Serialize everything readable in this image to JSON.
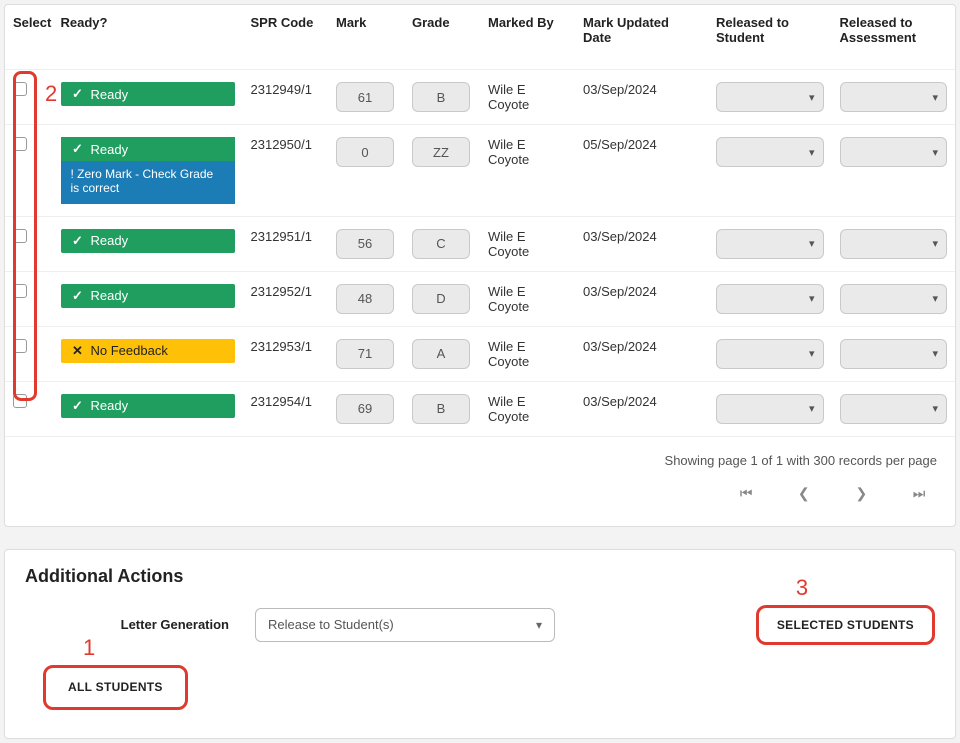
{
  "headers": {
    "select": "Select",
    "ready": "Ready?",
    "spr": "SPR Code",
    "mark": "Mark",
    "grade": "Grade",
    "by": "Marked By",
    "date": "Mark Updated Date",
    "rel_student": "Released to Student",
    "rel_assessment": "Released to Assessment"
  },
  "badge_labels": {
    "ready": "Ready",
    "no_feedback": "No Feedback",
    "zero_mark": "! Zero Mark - Check Grade is correct"
  },
  "rows": [
    {
      "ready_type": "ready",
      "spr": "2312949/1",
      "mark": "61",
      "grade": "B",
      "by": "Wile E Coyote",
      "date": "03/Sep/2024"
    },
    {
      "ready_type": "ready_warn",
      "spr": "2312950/1",
      "mark": "0",
      "grade": "ZZ",
      "by": "Wile E Coyote",
      "date": "05/Sep/2024"
    },
    {
      "ready_type": "ready",
      "spr": "2312951/1",
      "mark": "56",
      "grade": "C",
      "by": "Wile E Coyote",
      "date": "03/Sep/2024"
    },
    {
      "ready_type": "ready",
      "spr": "2312952/1",
      "mark": "48",
      "grade": "D",
      "by": "Wile E Coyote",
      "date": "03/Sep/2024"
    },
    {
      "ready_type": "nofeedback",
      "spr": "2312953/1",
      "mark": "71",
      "grade": "A",
      "by": "Wile E Coyote",
      "date": "03/Sep/2024"
    },
    {
      "ready_type": "ready",
      "spr": "2312954/1",
      "mark": "69",
      "grade": "B",
      "by": "Wile E Coyote",
      "date": "03/Sep/2024"
    }
  ],
  "footer": {
    "paging_text": "Showing page 1 of 1 with 300 records per page"
  },
  "actions": {
    "title": "Additional Actions",
    "letter_label": "Letter Generation",
    "select_value": "Release to Student(s)",
    "btn_selected": "SELECTED STUDENTS",
    "btn_all": "ALL STUDENTS"
  },
  "annotations": {
    "n1": "1",
    "n2": "2",
    "n3": "3"
  }
}
